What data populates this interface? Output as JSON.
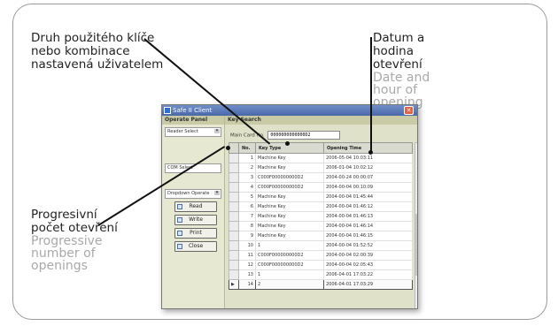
{
  "callouts": {
    "key_type": {
      "cz": "Druh použitého klíče nebo kombinace nastavená uživatelem"
    },
    "date": {
      "cz": "Datum a hodina otevření",
      "en": "Date and hour of opening"
    },
    "progressive": {
      "cz": "Progresivní počet otevření",
      "en": "Progressive number of openings"
    }
  },
  "app": {
    "title": "Safe II Client",
    "left_header": "Operate Panel",
    "reader_select": "Reader Select",
    "com_select": "COM Select",
    "dropdown_operate": "Dropdown Operate",
    "buttons": [
      "Read",
      "Write",
      "Print",
      "Close"
    ],
    "right_header": "Key Search",
    "card_label": "Main Card No.",
    "card_value": "0000000000000D2",
    "columns": [
      "No.",
      "Key Type",
      "Opening Time"
    ],
    "rows": [
      {
        "no": "1",
        "type": "Machine Key",
        "time": "2006-05-04 10:03:11"
      },
      {
        "no": "2",
        "type": "Machine Key",
        "time": "2006-01-04 10:02:12"
      },
      {
        "no": "3",
        "type": "C000F000000000D2",
        "time": "2004-00-24 00:00:07"
      },
      {
        "no": "4",
        "type": "C000F000000000D2",
        "time": "2004-00-04 00:10:09"
      },
      {
        "no": "5",
        "type": "Machine Key",
        "time": "2004-00-04 01:45:44"
      },
      {
        "no": "6",
        "type": "Machine Key",
        "time": "2004-00-04 01:46:12"
      },
      {
        "no": "7",
        "type": "Machine Key",
        "time": "2004-00-04 01:46:13"
      },
      {
        "no": "8",
        "type": "Machine Key",
        "time": "2004-00-04 01:46:14"
      },
      {
        "no": "9",
        "type": "Machine Key",
        "time": "2004-00-04 01:46:15"
      },
      {
        "no": "10",
        "type": "1",
        "time": "2004-00-04 01:52:52"
      },
      {
        "no": "11",
        "type": "C000F000000000D2",
        "time": "2004-00-04 02:00:39"
      },
      {
        "no": "12",
        "type": "C000F000000000D2",
        "time": "2004-00-04 02:05:43"
      },
      {
        "no": "13",
        "type": "1",
        "time": "2006-04-01 17:03:22"
      },
      {
        "no": "14",
        "type": "2",
        "time": "2006-04-01 17:03:29"
      }
    ]
  }
}
